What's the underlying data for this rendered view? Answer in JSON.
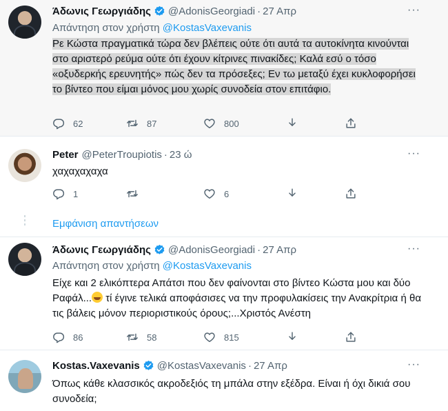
{
  "tweets": [
    {
      "name": "Άδωνις Γεωργιάδης",
      "handle": "@AdonisGeorgiadi",
      "time": "27 Απρ",
      "reply_prefix": "Απάντηση στον χρήστη",
      "reply_handle": "@KostasVaxevanis",
      "text": "Ρε Κώστα πραγματικά τώρα δεν βλέπεις ούτε ότι αυτά τα αυτοκίνητα κινούνται στο αριστερό ρεύμα ούτε ότι έχουν κίτρινες πινακίδες; Καλά εσύ ο τόσο «οξυδερκής ερευνητής» πώς δεν τα πρόσεξες; Εν τω μεταξύ έχει κυκλοφορήσει το βίντεο που είμαι μόνος μου χωρίς συνοδεία στον επιτάφιο.",
      "replies": "62",
      "retweets": "87",
      "likes": "800"
    },
    {
      "name": "Peter",
      "handle": "@PeterTroupiotis",
      "time": "23 ώ",
      "text": "χαχαχαχαχα",
      "replies": "1",
      "retweets": "",
      "likes": "6"
    },
    {
      "name": "Άδωνις Γεωργιάδης",
      "handle": "@AdonisGeorgiadi",
      "time": "27 Απρ",
      "reply_prefix": "Απάντηση στον χρήστη",
      "reply_handle": "@KostasVaxevanis",
      "text_before_emoji": "Είχε και 2 ελικόπτερα Απάτσι που δεν φαίνονται στο βίντεο Κώστα μου και δύο Ραφάλ...",
      "text_after_emoji": " τί έγινε τελικά αποφάσισες να την προφυλακίσεις την Ανακρίτρια ή θα τις βάλεις μόνον περιοριστικούς όρους;...Χριστός Ανέστη",
      "replies": "86",
      "retweets": "58",
      "likes": "815"
    },
    {
      "name": "Kostas.Vaxevanis",
      "handle": "@KostasVaxevanis",
      "time": "27 Απρ",
      "text": "Όπως κάθε κλασσικός ακροδεξιός τη μπάλα στην εξέδρα. Είναι ή όχι δικιά σου συνοδεία;"
    }
  ],
  "show_replies_label": "Εμφάνιση απαντήσεων",
  "more_label": "···",
  "colors": {
    "accent": "#1d9bf0",
    "muted": "#536471",
    "highlight_bg": "#f7f7f7"
  }
}
